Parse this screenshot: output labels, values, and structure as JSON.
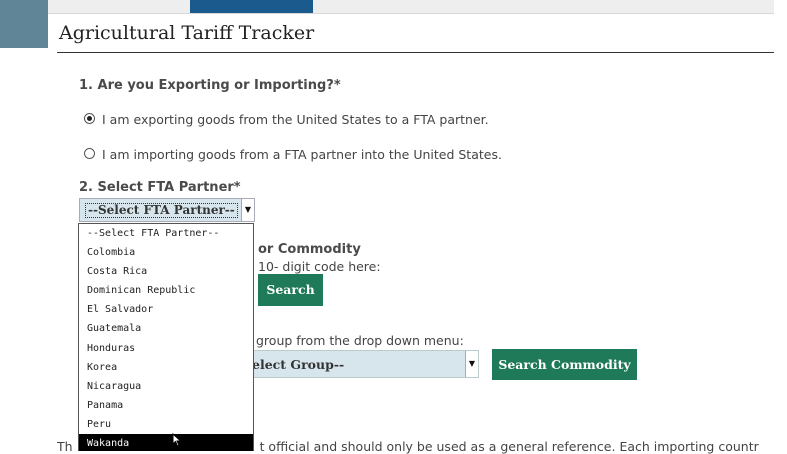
{
  "header": {
    "title": "Agricultural Tariff Tracker"
  },
  "question1": {
    "label": "1. Are you Exporting or Importing?*",
    "options": [
      {
        "label": "I am exporting goods from the United States to a FTA partner.",
        "selected": true
      },
      {
        "label": "I am importing goods from a FTA partner into the United States.",
        "selected": false
      }
    ]
  },
  "question2": {
    "label": "2. Select FTA Partner*",
    "selected_value": "--Select FTA Partner--",
    "options": [
      "--Select FTA Partner--",
      "Colombia",
      "Costa Rica",
      "Dominican Republic",
      "El Salvador",
      "Guatemala",
      "Honduras",
      "Korea",
      "Nicaragua",
      "Panama",
      "Peru",
      "Wakanda"
    ],
    "highlighted_option": "Wakanda"
  },
  "question3": {
    "label_fragment": "or Commodity",
    "hint_fragment": "10- digit code here:",
    "search_button": "Search",
    "group_hint_fragment": "group from the drop down menu:",
    "group_selected_fragment": "elect Group--",
    "search_commodity_button": "Search Commodity"
  },
  "footer": {
    "text_start": "Th",
    "text_fragment": "t official and should only be used as a general reference. Each importing countr"
  },
  "colors": {
    "accent_green": "#1f7a5a",
    "select_bg": "#d6e6ec",
    "topbar_active": "#1a5a8d",
    "left_block": "#5f8596"
  }
}
